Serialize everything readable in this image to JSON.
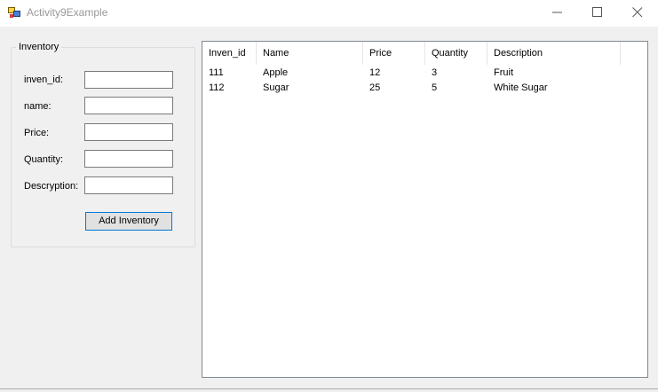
{
  "window": {
    "title": "Activity9Example"
  },
  "inventory_group": {
    "legend": "Inventory",
    "fields": [
      {
        "label": "inven_id:",
        "value": ""
      },
      {
        "label": "name:",
        "value": ""
      },
      {
        "label": "Price:",
        "value": ""
      },
      {
        "label": "Quantity:",
        "value": ""
      },
      {
        "label": "Descryption:",
        "value": ""
      }
    ],
    "add_button_label": "Add Inventory"
  },
  "listview": {
    "columns": [
      "Inven_id",
      "Name",
      "Price",
      "Quantity",
      "Description"
    ],
    "rows": [
      [
        "111",
        "Apple",
        "12",
        "3",
        "Fruit"
      ],
      [
        "112",
        "Sugar",
        "25",
        "5",
        "White Sugar"
      ]
    ]
  },
  "colors": {
    "button_focus_border": "#0078d7",
    "title_text": "#999999",
    "window_bg": "#f0f0f0"
  },
  "icons": [
    "app-icon",
    "minimize-icon",
    "maximize-icon",
    "close-icon"
  ]
}
